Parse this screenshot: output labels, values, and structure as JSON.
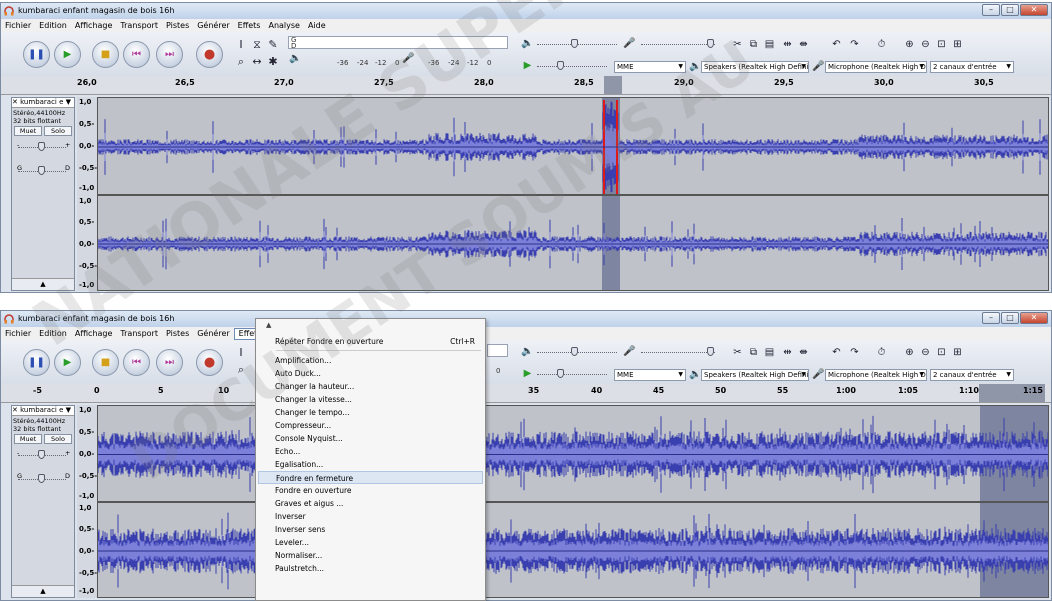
{
  "window_title": "kumbaraci enfant magasin de bois 16h",
  "window_buttons": [
    "–",
    "□",
    "✕"
  ],
  "menus": [
    "Fichier",
    "Edition",
    "Affichage",
    "Transport",
    "Pistes",
    "Générer",
    "Effets",
    "Analyse",
    "Aide"
  ],
  "meter": {
    "L": "G",
    "R": "D",
    "ticks": [
      "-36",
      "-24",
      "-12",
      "0"
    ]
  },
  "device": {
    "host": "MME",
    "output": "Speakers (Realtek High Definit",
    "input": "Microphone (Realtek High Defi",
    "channels": "2 canaux d'entrée"
  },
  "ruler_top": [
    "26,0",
    "26,5",
    "27,0",
    "27,5",
    "28,0",
    "28,5",
    "29,0",
    "29,5",
    "30,0",
    "30,5"
  ],
  "ruler_bottom": [
    "-5",
    "0",
    "5",
    "10",
    "35",
    "40",
    "45",
    "50",
    "55",
    "1:00",
    "1:05",
    "1:10",
    "1:15"
  ],
  "track": {
    "name": "kumbaraci e",
    "rate": "Stéréo,44100Hz",
    "format": "32 bits flottant",
    "mute": "Muet",
    "solo": "Solo",
    "gain_minus": "-",
    "gain_plus": "+",
    "pan_left": "G",
    "pan_right": "D",
    "collapse": "▲"
  },
  "scale_labels": [
    "1,0",
    "0,5-",
    "0,0-",
    "-0,5-",
    "-1,0"
  ],
  "effects_menu": {
    "items": [
      {
        "label": "Répéter Fondre en ouverture",
        "shortcut": "Ctrl+R"
      },
      {
        "label": "Amplification...",
        "shortcut": ""
      },
      {
        "label": "Auto Duck...",
        "shortcut": ""
      },
      {
        "label": "Changer la hauteur...",
        "shortcut": ""
      },
      {
        "label": "Changer la vitesse...",
        "shortcut": ""
      },
      {
        "label": "Changer le tempo...",
        "shortcut": ""
      },
      {
        "label": "Compresseur...",
        "shortcut": ""
      },
      {
        "label": "Console Nyquist...",
        "shortcut": ""
      },
      {
        "label": "Echo...",
        "shortcut": ""
      },
      {
        "label": "Egalisation...",
        "shortcut": ""
      },
      {
        "label": "Fondre en fermeture",
        "shortcut": ""
      },
      {
        "label": "Fondre en ouverture",
        "shortcut": ""
      },
      {
        "label": "Graves et aigus ...",
        "shortcut": ""
      },
      {
        "label": "Inverser",
        "shortcut": ""
      },
      {
        "label": "Inverser sens",
        "shortcut": ""
      },
      {
        "label": "Leveler...",
        "shortcut": ""
      },
      {
        "label": "Normaliser...",
        "shortcut": ""
      },
      {
        "label": "Paulstretch...",
        "shortcut": ""
      }
    ],
    "highlighted": "Fondre en fermeture",
    "scroll_up": "▲"
  },
  "watermark": {
    "line1": "NATIONALE SUPERIEURE",
    "line2": "DOCUMENT SOUMIS AU"
  },
  "colors": {
    "waveform": "#3a3fb0",
    "waveform_light": "#7c80d8",
    "selection": "#8f96a8",
    "selection_region": "#7e85a0",
    "clip_red": "#e01818"
  }
}
